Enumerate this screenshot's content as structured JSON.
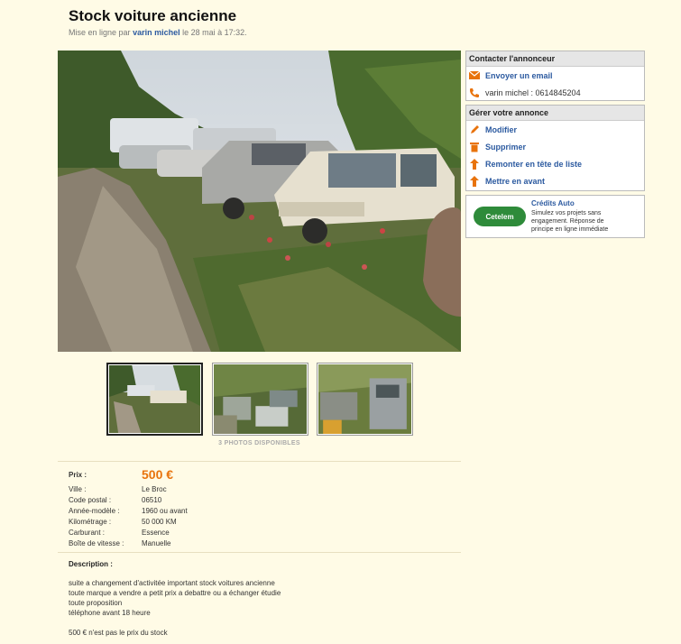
{
  "ad": {
    "title": "Stock voiture ancienne",
    "meta_prefix": "Mise en ligne par",
    "author": "varin michel",
    "meta_suffix": "le 28 mai à 17:32."
  },
  "photos": {
    "count_label": "3 PHOTOS DISPONIBLES"
  },
  "contact": {
    "header": "Contacter l'annonceur",
    "email_label": "Envoyer un email",
    "phone_text": "varin michel : 0614845204"
  },
  "manage": {
    "header": "Gérer votre annonce",
    "items": [
      "Modifier",
      "Supprimer",
      "Remonter en tête de liste",
      "Mettre en avant"
    ]
  },
  "promo": {
    "logo": "Cetelem",
    "title": "Crédits Auto",
    "lines": [
      "Simulez vos projets sans",
      "engagement. Réponse de",
      "principe en ligne immédiate"
    ]
  },
  "details": {
    "price_label": "Prix :",
    "price_value": "500 €",
    "rows": [
      {
        "k": "Ville :",
        "v": "Le Broc"
      },
      {
        "k": "Code postal :",
        "v": "06510"
      },
      {
        "k": "Année-modèle :",
        "v": "1960 ou avant"
      },
      {
        "k": "Kilométrage :",
        "v": "50 000 KM"
      },
      {
        "k": "Carburant :",
        "v": "Essence"
      },
      {
        "k": "Boîte de vitesse :",
        "v": "Manuelle"
      }
    ]
  },
  "description": {
    "title": "Description :",
    "lines": [
      "suite a changement d'activitée important stock voitures ancienne",
      "toute marque a vendre a petit prix a debattre ou a échanger étudie",
      "toute proposition",
      "téléphone avant 18 heure",
      "",
      "500 € n'est pas le prix du stock"
    ]
  },
  "colors": {
    "background": "#fffbe6",
    "link": "#2c5aa0",
    "price": "#e8730c",
    "icon_orange": "#e8730c"
  }
}
